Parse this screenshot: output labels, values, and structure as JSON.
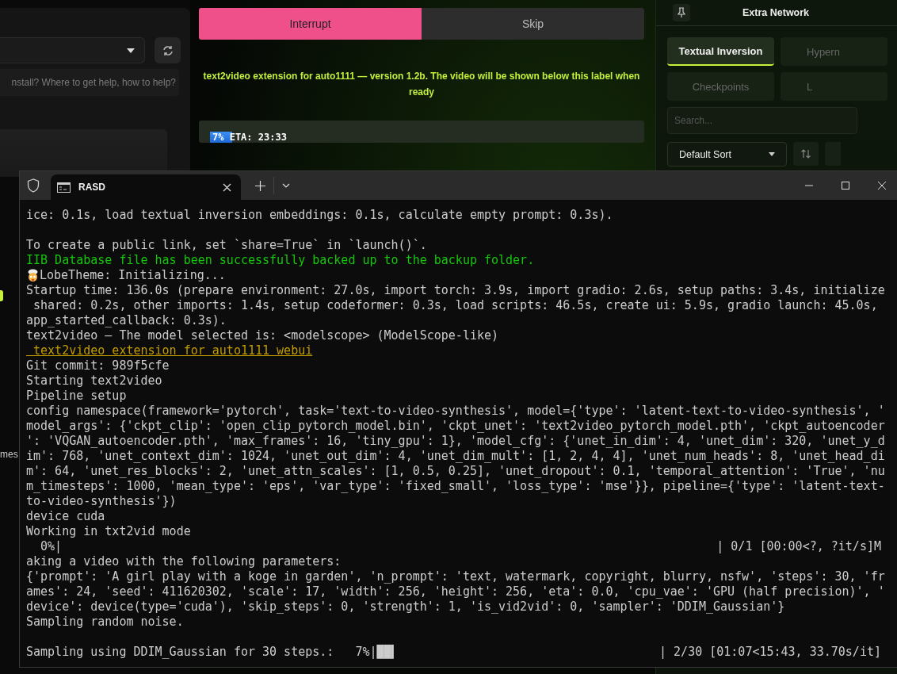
{
  "left_panel": {
    "help_field": {
      "placeholder": "nstall? Where to get help, how to help?"
    },
    "side_label": "mes"
  },
  "main": {
    "buttons": [
      {
        "label": "Interrupt",
        "kind": "primary"
      },
      {
        "label": "Skip",
        "kind": "secondary"
      }
    ],
    "notice": "text2video extension for auto1111 — version 1.2b. The video will be shown below this label when ready",
    "progress": {
      "level": 0.07,
      "label": "7% ETA: 23:33"
    }
  },
  "extra_network": {
    "title": "Extra Network",
    "tabs": [
      {
        "label": "Textual Inversion",
        "selected": true
      },
      {
        "label": "Hypern",
        "selected": false
      },
      {
        "label": "Checkpoints",
        "selected": false
      },
      {
        "label": "L",
        "selected": false
      }
    ],
    "search": {
      "placeholder": "Search..."
    },
    "sort": {
      "value": "Default Sort"
    }
  },
  "terminal": {
    "tab_title": "RASD",
    "lines": [
      {
        "kind": "text",
        "text": "ice: 0.1s, load textual inversion embeddings: 0.1s, calculate empty prompt: 0.3s)."
      },
      {
        "kind": "blank"
      },
      {
        "kind": "text",
        "text": "To create a public link, set `share=True` in `launch()`."
      },
      {
        "kind": "success",
        "text": "IIB Database file has been successfully backed up to the backup folder."
      },
      {
        "kind": "emoji",
        "text": "LobeTheme: Initializing..."
      },
      {
        "kind": "text",
        "text": "Startup time: 136.0s (prepare environment: 27.0s, import torch: 3.9s, import gradio: 2.6s, setup paths: 3.4s, initialize"
      },
      {
        "kind": "text",
        "text": " shared: 0.2s, other imports: 1.4s, setup codeformer: 0.3s, load scripts: 46.5s, create ui: 5.9s, gradio launch: 45.0s,"
      },
      {
        "kind": "text",
        "text": "app_started_callback: 0.3s)."
      },
      {
        "kind": "text",
        "text": "text2video — The model selected is: <modelscope> (ModelScope-like)"
      },
      {
        "kind": "link",
        "text": " text2video extension for auto1111 webui"
      },
      {
        "kind": "text",
        "text": "Git commit: 989f5cfe"
      },
      {
        "kind": "text",
        "text": "Starting text2video"
      },
      {
        "kind": "text",
        "text": "Pipeline setup"
      },
      {
        "kind": "text",
        "text": "config namespace(framework='pytorch', task='text-to-video-synthesis', model={'type': 'latent-text-to-video-synthesis', '"
      },
      {
        "kind": "text",
        "text": "model_args': {'ckpt_clip': 'open_clip_pytorch_model.bin', 'ckpt_unet': 'text2video_pytorch_model.pth', 'ckpt_autoencoder"
      },
      {
        "kind": "text",
        "text": "': 'VQGAN_autoencoder.pth', 'max_frames': 16, 'tiny_gpu': 1}, 'model_cfg': {'unet_in_dim': 4, 'unet_dim': 320, 'unet_y_d"
      },
      {
        "kind": "text",
        "text": "im': 768, 'unet_context_dim': 1024, 'unet_out_dim': 4, 'unet_dim_mult': [1, 2, 4, 4], 'unet_num_heads': 8, 'unet_head_di"
      },
      {
        "kind": "text",
        "text": "m': 64, 'unet_res_blocks': 2, 'unet_attn_scales': [1, 0.5, 0.25], 'unet_dropout': 0.1, 'temporal_attention': 'True', 'nu"
      },
      {
        "kind": "text",
        "text": "m_timesteps': 1000, 'mean_type': 'eps', 'var_type': 'fixed_small', 'loss_type': 'mse'}}, pipeline={'type': 'latent-text-"
      },
      {
        "kind": "text",
        "text": "to-video-synthesis'})"
      },
      {
        "kind": "text",
        "text": "device cuda"
      },
      {
        "kind": "text",
        "text": "Working in txt2vid mode"
      },
      {
        "kind": "progress",
        "text": "  0%|",
        "right": "| 0/1 [00:00<?, ?it/s]M"
      },
      {
        "kind": "text",
        "text": "aking a video with the following parameters:"
      },
      {
        "kind": "text",
        "text": "{'prompt': 'A girl play with a koge in garden', 'n_prompt': 'text, watermark, copyright, blurry, nsfw', 'steps': 30, 'fr"
      },
      {
        "kind": "text",
        "text": "ames': 24, 'seed': 411620302, 'scale': 17, 'width': 256, 'height': 256, 'eta': 0.0, 'cpu_vae': 'GPU (half precision)', '"
      },
      {
        "kind": "text",
        "text": "device': device(type='cuda'), 'skip_steps': 0, 'strength': 1, 'is_vid2vid': 0, 'sampler': 'DDIM_Gaussian'}"
      },
      {
        "kind": "text",
        "text": "Sampling random noise."
      },
      {
        "kind": "blank"
      },
      {
        "kind": "progress",
        "text": "Sampling using DDIM_Gaussian for 30 steps.:   7%|██▍",
        "right": "| 2/30 [01:07<15:43, 33.70s/it]"
      }
    ]
  }
}
